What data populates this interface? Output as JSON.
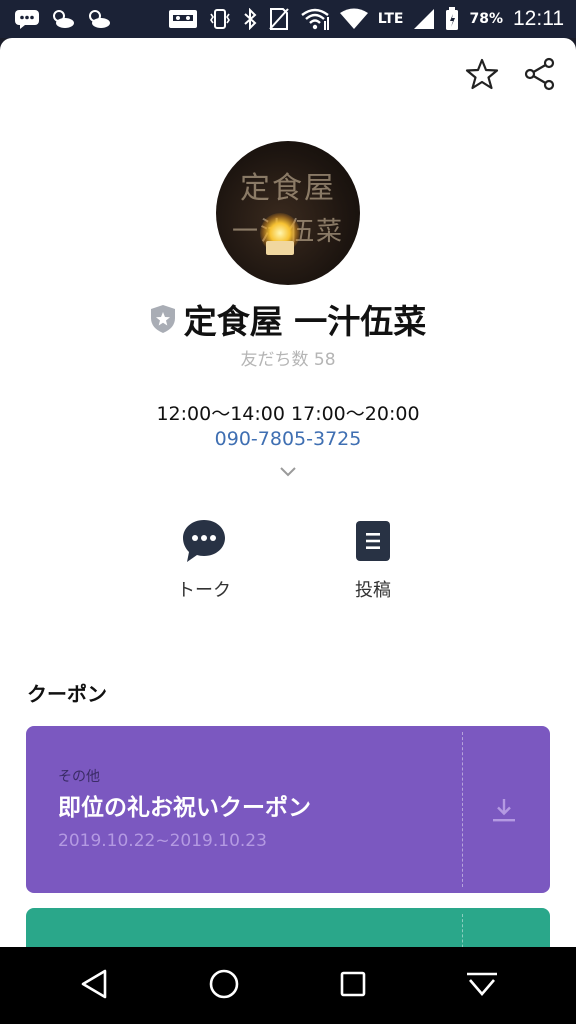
{
  "status_bar": {
    "network": "LTE",
    "battery": "78%",
    "time": "12:11"
  },
  "profile": {
    "avatar_sign": [
      "定食屋",
      "一汁伍菜"
    ],
    "name": "定食屋 一汁伍菜",
    "friends_label": "友だち数 58",
    "hours": "12:00〜14:00 17:00〜20:00",
    "phone": "090-7805-3725"
  },
  "actions": {
    "talk_label": "トーク",
    "post_label": "投稿"
  },
  "coupons": {
    "section_title": "クーポン",
    "items": [
      {
        "category": "その他",
        "title": "即位の礼お祝いクーポン",
        "dates": "2019.10.22~2019.10.23",
        "color": "#7b58c0"
      },
      {
        "color": "#2aa78a"
      }
    ]
  },
  "colors": {
    "status_bar_bg": "#1b2236",
    "link": "#3f6fb2",
    "coupon_purple": "#7b58c0",
    "coupon_green": "#2aa78a"
  },
  "icons": {
    "top": [
      "star-icon",
      "share-icon"
    ],
    "nav": [
      "back-icon",
      "home-icon",
      "recents-icon",
      "hide-nav-icon"
    ]
  }
}
